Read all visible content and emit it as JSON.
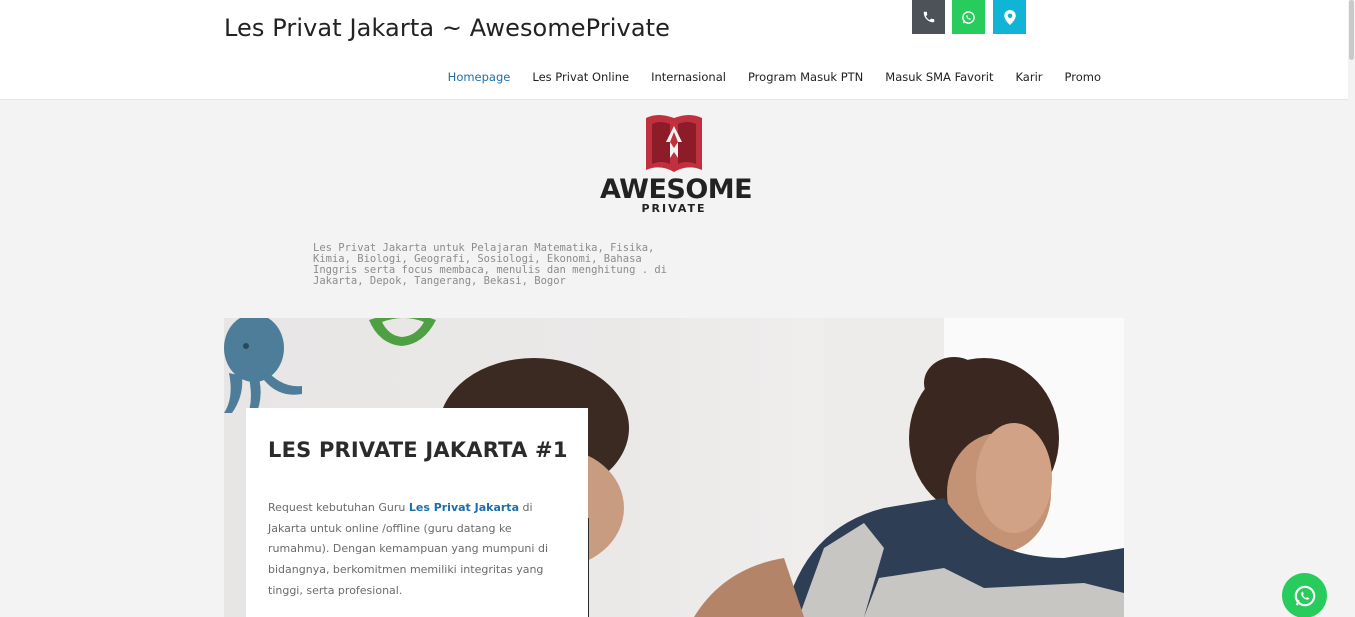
{
  "header": {
    "site_title": "Les Privat Jakarta ~ AwesomePrivate",
    "nav": [
      {
        "label": "Homepage",
        "active": true
      },
      {
        "label": "Les Privat Online"
      },
      {
        "label": "Internasional"
      },
      {
        "label": "Program Masuk PTN"
      },
      {
        "label": "Masuk SMA Favorit"
      },
      {
        "label": "Karir"
      },
      {
        "label": "Promo"
      }
    ]
  },
  "logo": {
    "word": "AWESOME",
    "sub": "PRIVATE",
    "colors": {
      "mark": "#c0313d",
      "text": "#222222"
    }
  },
  "tagline": "Les Privat Jakarta untuk Pelajaran Matematika, Fisika, Kimia, Biologi, Geografi, Sosiologi, Ekonomi, Bahasa Inggris serta focus membaca, menulis dan menghitung . di Jakarta, Depok, Tangerang, Bekasi, Bogor",
  "social": [
    {
      "icon": "phone-icon",
      "color": "#4d5259"
    },
    {
      "icon": "whatsapp-icon",
      "color": "#27cc5c"
    },
    {
      "icon": "map-marker-icon",
      "color": "#10b5d6"
    }
  ],
  "hero": {
    "title": "LES PRIVATE JAKARTA #1",
    "text_before": "Request kebutuhan Guru ",
    "link": "Les Privat Jakarta",
    "text_after": " di Jakarta untuk online /offline (guru datang ke rumahmu). Dengan kemampuan yang mumpuni di bidangnya,  berkomitmen memiliki integritas yang tinggi, serta profesional."
  },
  "floating": {
    "icon": "whatsapp-icon",
    "color": "#27cc5c"
  }
}
